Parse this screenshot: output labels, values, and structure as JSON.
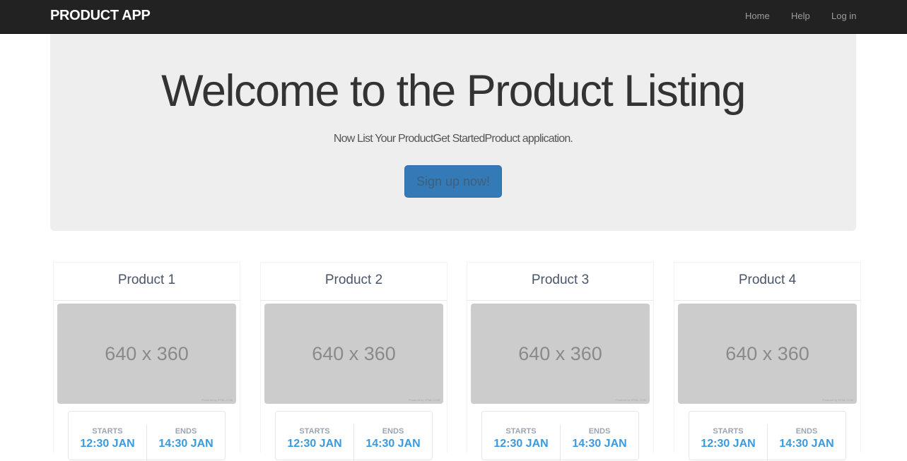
{
  "navbar": {
    "brand": "PRODUCT APP",
    "links": [
      "Home",
      "Help",
      "Log in"
    ]
  },
  "hero": {
    "title": "Welcome to the Product Listing",
    "subtitle": "Now List Your ProductGet StartedProduct application.",
    "cta_label": "Sign up now!"
  },
  "products": [
    {
      "title": "Product 1",
      "image_text": "640 x 360",
      "image_credit": "Powered by HTML.COM",
      "starts_label": "STARTS",
      "starts_value": "12:30 JAN",
      "ends_label": "ENDS",
      "ends_value": "14:30 JAN"
    },
    {
      "title": "Product 2",
      "image_text": "640 x 360",
      "image_credit": "Powered by HTML.COM",
      "starts_label": "STARTS",
      "starts_value": "12:30 JAN",
      "ends_label": "ENDS",
      "ends_value": "14:30 JAN"
    },
    {
      "title": "Product 3",
      "image_text": "640 x 360",
      "image_credit": "Powered by HTML.COM",
      "starts_label": "STARTS",
      "starts_value": "12:30 JAN",
      "ends_label": "ENDS",
      "ends_value": "14:30 JAN"
    },
    {
      "title": "Product 4",
      "image_text": "640 x 360",
      "image_credit": "Powered by HTML.COM",
      "starts_label": "STARTS",
      "starts_value": "12:30 JAN",
      "ends_label": "ENDS",
      "ends_value": "14:30 JAN"
    }
  ],
  "colors": {
    "navbar_bg": "#222222",
    "jumbotron_bg": "#eeeeee",
    "primary_button": "#337ab7",
    "time_value": "#3a9ae0"
  }
}
